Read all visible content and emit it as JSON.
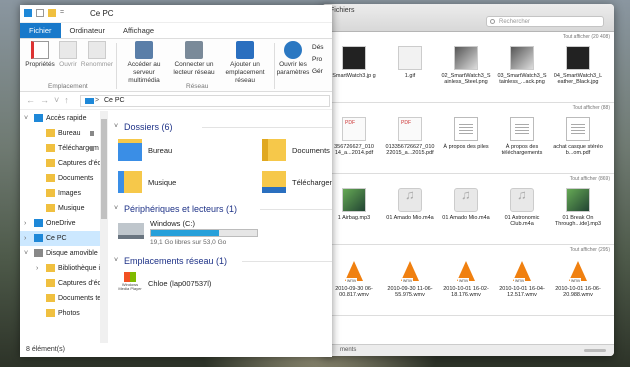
{
  "explorer": {
    "title": "Ce PC",
    "quick_access_sep": "=",
    "tabs": [
      "Fichier",
      "Ordinateur",
      "Affichage"
    ],
    "ribbon": {
      "properties": "Propriétés",
      "open": "Ouvrir",
      "rename": "Renommer",
      "group_location": "Emplacement",
      "media_server": "Accéder au serveur multimédia",
      "map_drive": "Connecter un lecteur réseau",
      "add_location": "Ajouter un emplacement réseau",
      "group_network": "Réseau",
      "open_settings": "Ouvrir les paramètres",
      "uninstall": "Dés",
      "system_props": "Pro",
      "manage": "Gér"
    },
    "address": {
      "path": "Ce PC",
      "crumb_sep": ">"
    },
    "nav": [
      {
        "label": "Accès rapide",
        "level": 0,
        "chevron": "v"
      },
      {
        "label": "Bureau",
        "level": 1,
        "pin": true
      },
      {
        "label": "Téléchargem",
        "level": 1,
        "pin": true
      },
      {
        "label": "Captures d'éc",
        "level": 1
      },
      {
        "label": "Documents",
        "level": 1
      },
      {
        "label": "Images",
        "level": 1
      },
      {
        "label": "Musique",
        "level": 1
      },
      {
        "label": "OneDrive",
        "level": 0,
        "chevron": ">"
      },
      {
        "label": "Ce PC",
        "level": 0,
        "chevron": ">",
        "selected": true
      },
      {
        "label": "Disque amovible",
        "level": 0,
        "chevron": "v"
      },
      {
        "label": "Bibliothèque i",
        "level": 1,
        "chevron": ">"
      },
      {
        "label": "Captures d'éc",
        "level": 1
      },
      {
        "label": "Documents te",
        "level": 1
      },
      {
        "label": "Photos",
        "level": 1
      }
    ],
    "groups": {
      "folders": "Dossiers (6)",
      "devices": "Périphériques et lecteurs (1)",
      "network": "Emplacements réseau (1)"
    },
    "folders": [
      "Bureau",
      "Documents",
      "Musique",
      "Téléchargements"
    ],
    "drive": {
      "name": "Windows (C:)",
      "free": "19,1 Go libres sur 53,0 Go",
      "used_fraction": 0.64
    },
    "network_item": {
      "name": "Chloe (lap007537l)",
      "logo_text": "Windows Media Player"
    },
    "status": "8 élément(s)"
  },
  "mac": {
    "title": "Fichiers",
    "search_placeholder": "Rechercher",
    "status": "ments",
    "sections": [
      {
        "header": "Tout afficher (20 408)",
        "files": [
          {
            "name": "SmartWatch3.jp g",
            "kind": "dark"
          },
          {
            "name": "1.gif",
            "kind": "blank"
          },
          {
            "name": "02_SmartWatch3_S ainless_Steel.png",
            "kind": "img"
          },
          {
            "name": "03_SmartWatch3_S tainless_...ack.png",
            "kind": "img"
          },
          {
            "name": "04_SmartWatch3_L eather_Black.jpg",
            "kind": "dark"
          }
        ]
      },
      {
        "header": "Tout afficher (88)",
        "files": [
          {
            "name": "356726627_010 14_a...2014.pdf",
            "kind": "pdf"
          },
          {
            "name": "013356726627_010 22015_a...2015.pdf",
            "kind": "pdf"
          },
          {
            "name": "À propos des piles",
            "kind": "note"
          },
          {
            "name": "À propos des téléchargements",
            "kind": "note"
          },
          {
            "name": "achat casque stéréo b...om.pdf",
            "kind": "note"
          }
        ]
      },
      {
        "header": "Tout afficher (869)",
        "files": [
          {
            "name": "1 Airbag.mp3",
            "kind": "album"
          },
          {
            "name": "01 Amado Mio.m4a",
            "kind": "music"
          },
          {
            "name": "01 Amado Mio.m4a",
            "kind": "music"
          },
          {
            "name": "01 Astronomic Club.m4a",
            "kind": "music"
          },
          {
            "name": "01 Break On Through...ide].mp3",
            "kind": "album"
          }
        ]
      },
      {
        "header": "Tout afficher (295)",
        "files": [
          {
            "name": "2010-09-30 06-00.817.wmv",
            "kind": "vlc"
          },
          {
            "name": "2010-09-30 11-06-55.975.wmv",
            "kind": "vlc"
          },
          {
            "name": "2010-10-01 16-02-18.176.wmv",
            "kind": "vlc"
          },
          {
            "name": "2010-10-01 16-04-12.517.wmv",
            "kind": "vlc"
          },
          {
            "name": "2010-10-01 16-06-20.988.wmv",
            "kind": "vlc"
          }
        ]
      }
    ]
  }
}
